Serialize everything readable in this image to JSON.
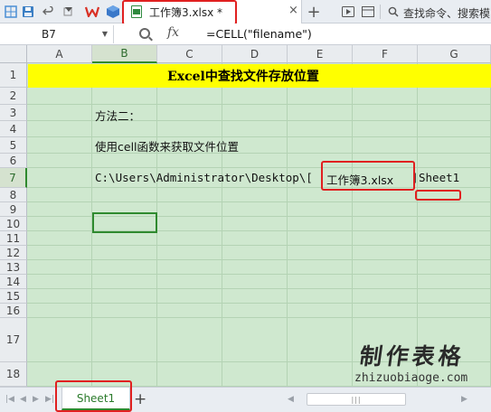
{
  "toolbar": {
    "doc_tab_name": "工作簿3.xlsx *",
    "doc_tab_close": "×",
    "add_tab": "+",
    "search_label": "查找命令、搜索模"
  },
  "formula_bar": {
    "name_box": "B7",
    "fx_label": "fx",
    "formula": "=CELL(\"filename\")"
  },
  "grid": {
    "columns": [
      "A",
      "B",
      "C",
      "D",
      "E",
      "F",
      "G"
    ],
    "rows": [
      "1",
      "2",
      "3",
      "4",
      "5",
      "6",
      "7",
      "8",
      "9",
      "10",
      "11",
      "12",
      "13",
      "14",
      "15",
      "16",
      "17",
      "18"
    ],
    "active_column": "B",
    "active_row": "7"
  },
  "cells": {
    "title": "Excel中查找文件存放位置",
    "b3": "方法二：",
    "b5": "使用cell函数来获取文件位置",
    "b7_path": "C:\\Users\\Administrator\\Desktop\\[",
    "b7_file": "工作簿3.xlsx",
    "b7_bracket": "]",
    "b7_sheet": "Sheet1"
  },
  "watermark": {
    "cn": "制作表格",
    "en": "zhizuobiaoge.com"
  },
  "sheet_bar": {
    "sheet_tab": "Sheet1",
    "add_sheet": "+",
    "scroll_grip": "|||"
  },
  "colors": {
    "grid_bg": "#cfe8cf",
    "title_bg": "#ffff00",
    "highlight": "#e02020",
    "selection": "#2f8a2f"
  }
}
